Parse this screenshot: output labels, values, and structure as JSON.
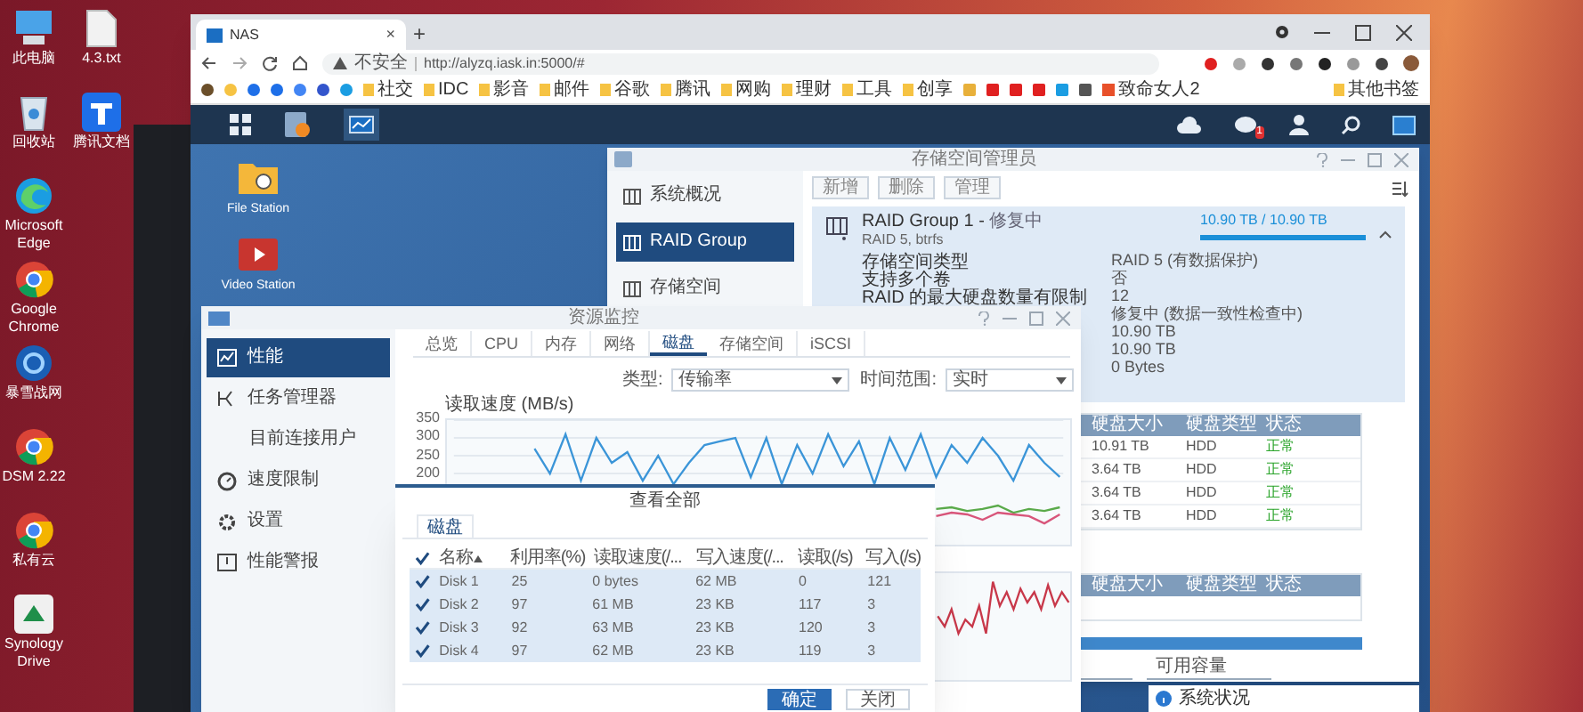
{
  "desktop_icons": [
    {
      "label": "此电脑",
      "kind": "computer"
    },
    {
      "label": "4.3.txt",
      "kind": "file"
    },
    {
      "label": "回收站",
      "kind": "bin"
    },
    {
      "label": "腾讯文档",
      "kind": "doc"
    },
    {
      "label": "Microsoft Edge",
      "kind": "edge"
    },
    {
      "label": "Google Chrome",
      "kind": "chrome"
    },
    {
      "label": "暴雪战网",
      "kind": "game"
    },
    {
      "label": "DSM 2.22",
      "kind": "chrome"
    },
    {
      "label": "私有云",
      "kind": "chrome"
    },
    {
      "label": "Synology Drive",
      "kind": "drive"
    }
  ],
  "browser": {
    "tab": {
      "title": "NAS",
      "close": "×"
    },
    "new_tab": "+",
    "security": "不安全",
    "url": "http://alyzq.iask.in:5000/#",
    "bookmarks": [
      {
        "label": "社交"
      },
      {
        "label": "IDC"
      },
      {
        "label": "影音"
      },
      {
        "label": "邮件"
      },
      {
        "label": "谷歌"
      },
      {
        "label": "腾讯"
      },
      {
        "label": "网购"
      },
      {
        "label": "理财"
      },
      {
        "label": "工具"
      },
      {
        "label": "创享"
      }
    ],
    "site_bookmark": "致命女人2",
    "other_bookmarks": "其他书签"
  },
  "dsm": {
    "notification_count": "1",
    "apps": [
      {
        "label": "File Station",
        "kind": "folder"
      },
      {
        "label": "Video Station",
        "kind": "video"
      }
    ]
  },
  "storage_manager": {
    "title": "存储空间管理员",
    "sidebar": [
      {
        "label": "系统概况",
        "selected": false
      },
      {
        "label": "RAID Group",
        "selected": true
      },
      {
        "label": "存储空间",
        "selected": false
      }
    ],
    "toolbar": [
      "新增",
      "删除",
      "管理"
    ],
    "raid": {
      "name": "RAID Group 1",
      "separator": "-",
      "status": "修复中",
      "subtitle": "RAID 5, btrfs",
      "usage": "10.90 TB / 10.90 TB",
      "level": 1,
      "details": [
        {
          "label": "存储空间类型",
          "value": "RAID 5 (有数据保护)"
        },
        {
          "label": "支持多个卷",
          "value": "否"
        },
        {
          "label": "RAID 的最大硬盘数量有限制",
          "value": "12"
        },
        {
          "value": "修复中 (数据一致性检查中)"
        },
        {
          "value": "10.90 TB"
        },
        {
          "value": "10.90 TB"
        },
        {
          "value": "0 Bytes"
        }
      ]
    },
    "disk_table": {
      "columns": [
        "硬盘大小",
        "硬盘类型",
        "状态"
      ],
      "rows": [
        [
          "10.91 TB",
          "HDD",
          "正常"
        ],
        [
          "3.64 TB",
          "HDD",
          "正常"
        ],
        [
          "3.64 TB",
          "HDD",
          "正常"
        ],
        [
          "3.64 TB",
          "HDD",
          "正常"
        ]
      ]
    },
    "spare_table": {
      "columns": [
        "硬盘大小",
        "硬盘类型",
        "状态"
      ]
    },
    "bottom_tab": "可用容量"
  },
  "status_widget": {
    "title": "系统状况"
  },
  "resource_monitor": {
    "title": "资源监控",
    "sidebar": [
      {
        "label": "性能",
        "selected": true,
        "kind": "chart"
      },
      {
        "label": "任务管理器",
        "selected": false,
        "kind": "tasks",
        "children": [
          {
            "label": "目前连接用户",
            "selected": false
          }
        ]
      },
      {
        "label": "速度限制",
        "selected": false,
        "kind": "gauge"
      },
      {
        "label": "设置",
        "selected": false,
        "kind": "gear"
      },
      {
        "label": "性能警报",
        "selected": false,
        "kind": "alert"
      }
    ],
    "tabs": [
      {
        "label": "总览",
        "selected": false
      },
      {
        "label": "CPU",
        "selected": false
      },
      {
        "label": "内存",
        "selected": false
      },
      {
        "label": "网络",
        "selected": false
      },
      {
        "label": "磁盘",
        "selected": true
      },
      {
        "label": "存储空间",
        "selected": false
      },
      {
        "label": "iSCSI",
        "selected": false
      }
    ],
    "filters": [
      {
        "label": "类型:",
        "value": "传输率"
      },
      {
        "label": "时间范围:",
        "value": "实时"
      }
    ],
    "chart_data": {
      "type": "line",
      "title": "读取速度 (MB/s)",
      "ylim": [
        0,
        350
      ],
      "yticks": [
        200,
        250,
        300,
        350
      ],
      "grid": true,
      "series": [
        {
          "color": "#3b95d8",
          "values": [
            null,
            null,
            null,
            null,
            null,
            270,
            200,
            310,
            180,
            300,
            230,
            260,
            180,
            250,
            170,
            230,
            280,
            290,
            300,
            190,
            300,
            170,
            280,
            200,
            310,
            220,
            290,
            170,
            300,
            210,
            310,
            190,
            280,
            230,
            300,
            250,
            180,
            280,
            230,
            190
          ]
        },
        {
          "color": "#5aaa4a",
          "values": [
            null,
            null,
            null,
            null,
            null,
            null,
            null,
            null,
            null,
            null,
            null,
            null,
            null,
            null,
            null,
            null,
            null,
            null,
            null,
            null,
            null,
            null,
            null,
            null,
            null,
            null,
            null,
            null,
            null,
            null,
            null,
            100,
            105,
            95,
            100,
            110,
            90,
            100,
            95,
            105
          ]
        },
        {
          "color": "#d8557a",
          "values": [
            null,
            null,
            null,
            null,
            null,
            null,
            null,
            null,
            null,
            null,
            null,
            null,
            null,
            null,
            null,
            null,
            null,
            null,
            null,
            null,
            null,
            null,
            null,
            null,
            null,
            null,
            null,
            null,
            null,
            null,
            null,
            80,
            90,
            85,
            70,
            90,
            85,
            80,
            60,
            85
          ]
        }
      ]
    }
  },
  "dialog": {
    "title": "查看全部",
    "tab": "磁盘",
    "header_checked": true,
    "columns": [
      "名称",
      "利用率(%)",
      "读取速度(/...",
      "写入速度(/...",
      "读取(/s)",
      "写入(/s)"
    ],
    "rows": [
      {
        "checked": true,
        "selected": true,
        "cells": [
          "Disk 1",
          "25",
          "0 bytes",
          "62 MB",
          "0",
          "121"
        ]
      },
      {
        "checked": true,
        "selected": true,
        "cells": [
          "Disk 2",
          "97",
          "61 MB",
          "23 KB",
          "117",
          "3"
        ]
      },
      {
        "checked": true,
        "selected": true,
        "cells": [
          "Disk 3",
          "92",
          "63 MB",
          "23 KB",
          "120",
          "3"
        ]
      },
      {
        "checked": true,
        "selected": true,
        "cells": [
          "Disk 4",
          "97",
          "62 MB",
          "23 KB",
          "119",
          "3"
        ]
      }
    ],
    "buttons": [
      {
        "label": "确定",
        "kind": "primary"
      },
      {
        "label": "关闭",
        "kind": "secondary"
      }
    ]
  }
}
